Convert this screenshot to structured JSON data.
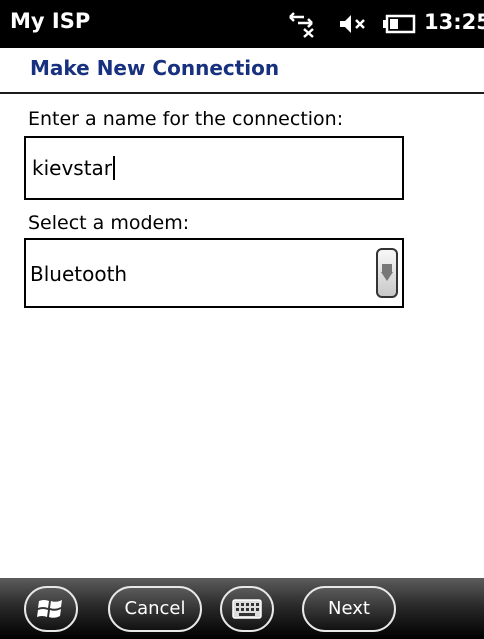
{
  "status_bar": {
    "app_title": "My ISP",
    "time": "13:25",
    "icons": [
      "data-connection-icon",
      "volume-muted-icon",
      "battery-icon"
    ]
  },
  "header": {
    "title": "Make New Connection"
  },
  "form": {
    "name_label": "Enter a name for the connection:",
    "name_value": "kievstar",
    "modem_label": "Select a modem:",
    "modem_value": "Bluetooth"
  },
  "softkeys": {
    "cancel_label": "Cancel",
    "next_label": "Next",
    "icons": [
      "windows-start-icon",
      "keyboard-icon"
    ]
  },
  "colors": {
    "title_blue": "#17317f",
    "bar_black": "#000000"
  }
}
